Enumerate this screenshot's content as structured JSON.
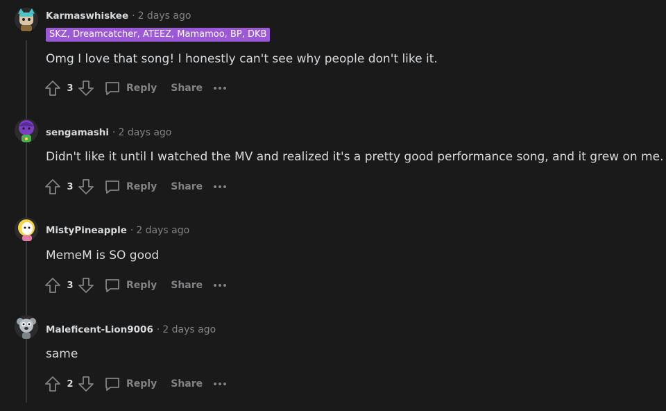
{
  "colors": {
    "background": "#1a1a1b",
    "text": "#d7dadc",
    "muted": "#818384",
    "flair_bg": "#9b59d6",
    "thread_line": "#343536"
  },
  "actions": {
    "reply_label": "Reply",
    "share_label": "Share"
  },
  "comments": [
    {
      "username": "Karmaswhiskee",
      "time": "2 days ago",
      "flair": "SKZ, Dreamcatcher, ATEEZ, Mamamoo, BP, DKB",
      "body": "Omg I love that song! I honestly can't see why people don't like it.",
      "score": "3",
      "avatar_icon": "cat-avatar-icon"
    },
    {
      "username": "sengamashi",
      "time": "2 days ago",
      "body": "Didn't like it until I watched the MV and realized it's a pretty good performance song, and it grew on me.",
      "score": "3",
      "avatar_icon": "purple-avatar-icon"
    },
    {
      "username": "MistyPineapple",
      "time": "2 days ago",
      "body": "MemeM is SO good",
      "score": "3",
      "avatar_icon": "blonde-avatar-icon"
    },
    {
      "username": "Maleficent-Lion9006",
      "time": "2 days ago",
      "body": "same",
      "score": "2",
      "avatar_icon": "koala-avatar-icon"
    }
  ]
}
